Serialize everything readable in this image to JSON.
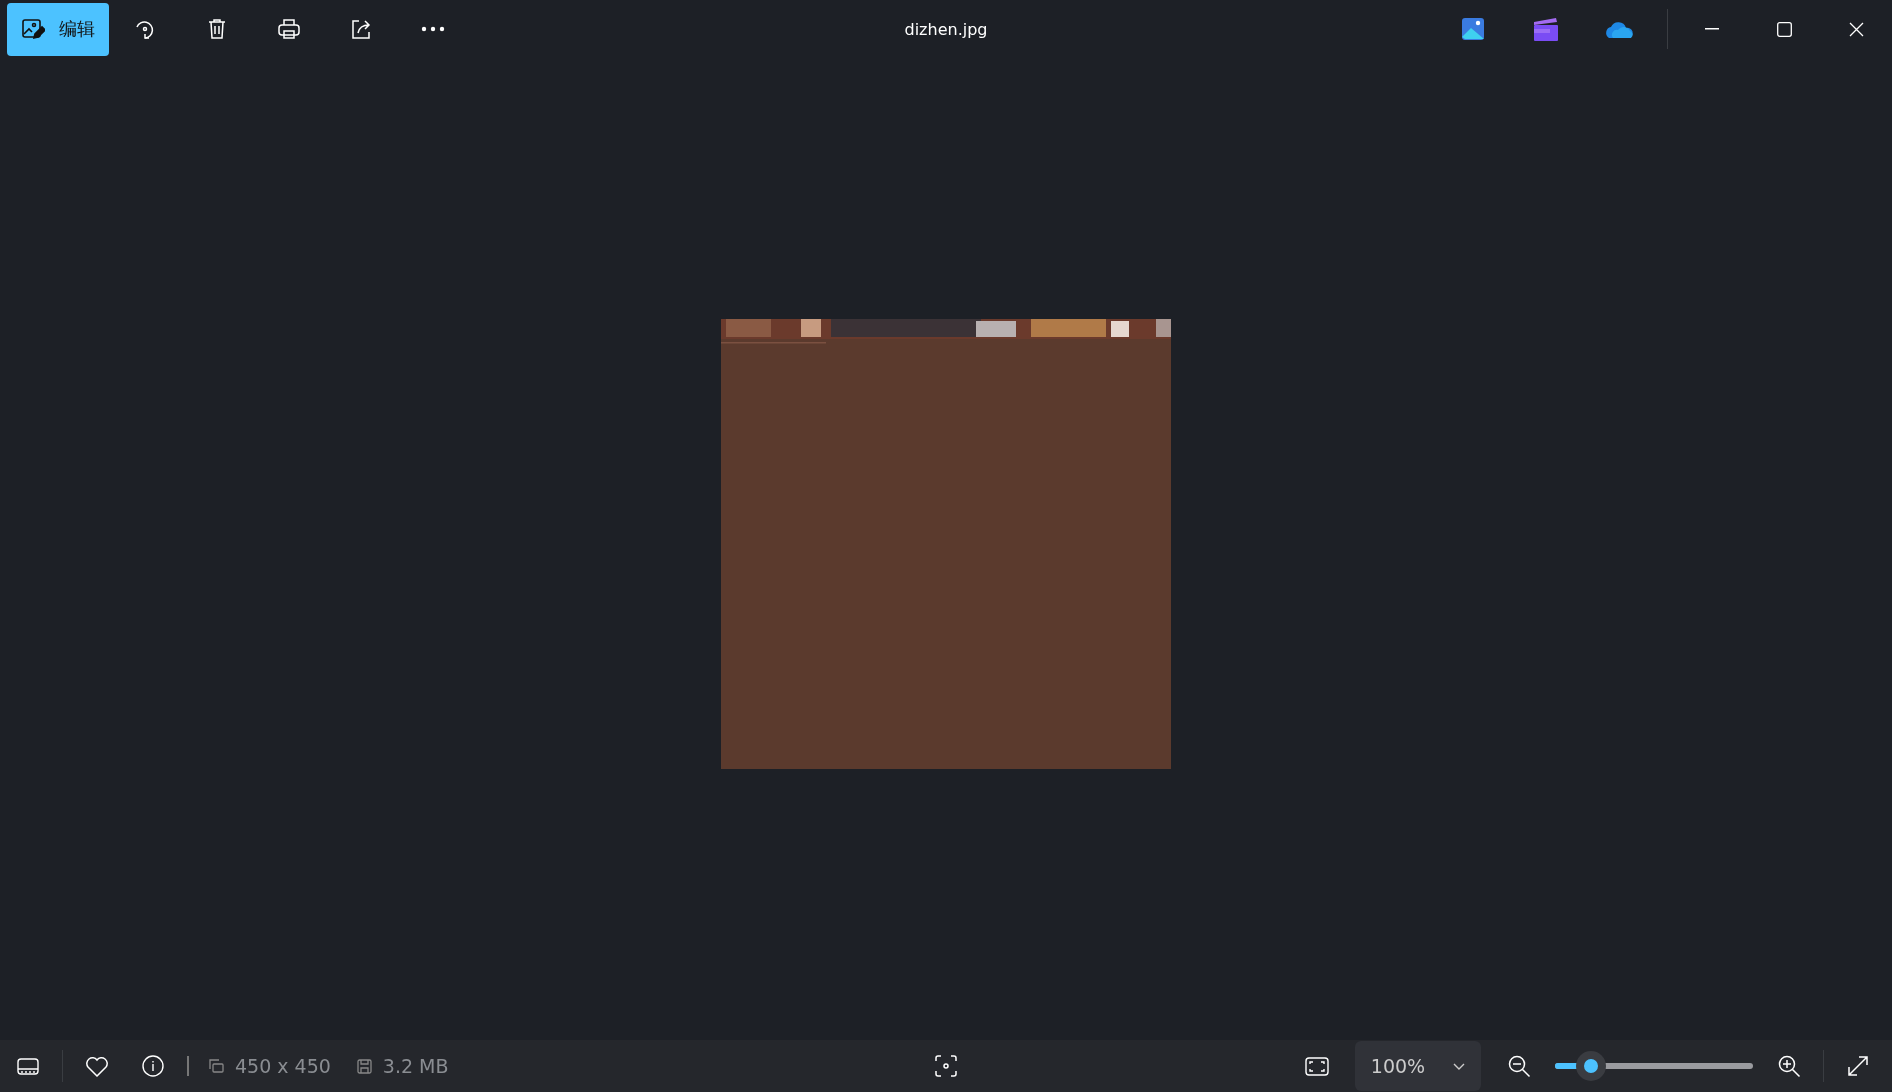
{
  "toolbar": {
    "edit_label": "编辑"
  },
  "title": "dizhen.jpg",
  "status_bar": {
    "dimensions": "450 x 450",
    "file_size": "3.2 MB",
    "zoom_value": "100%",
    "zoom_slider": {
      "level": 0.18
    }
  }
}
